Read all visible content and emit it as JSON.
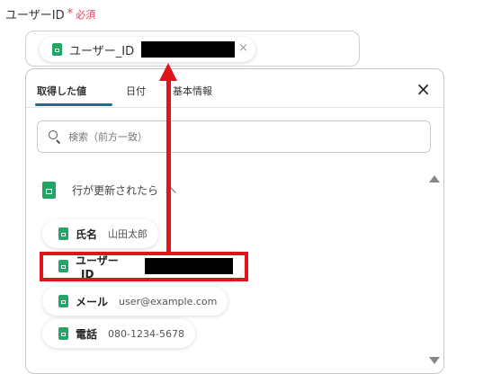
{
  "field": {
    "label": "ユーザーID",
    "required_mark": "*",
    "required_text": "必須",
    "token": {
      "label": "ユーザー_ID",
      "remove": "×"
    }
  },
  "popup": {
    "tabs": [
      {
        "label": "取得した値",
        "active": true
      },
      {
        "label": "日付",
        "active": false
      },
      {
        "label": "基本情報",
        "active": false
      }
    ],
    "close_label": "×",
    "search": {
      "placeholder": "検索（前方一致）",
      "value": ""
    },
    "group": {
      "title": "行が更新されたら",
      "items": [
        {
          "label": "氏名",
          "value": "山田太郎"
        },
        {
          "label": "ユーザー_ID",
          "value": ""
        },
        {
          "label": "メール",
          "value": "user@example.com"
        },
        {
          "label": "電話",
          "value": "080-1234-5678"
        }
      ]
    }
  },
  "colors": {
    "accent": "#1f6b8c",
    "sheets_green": "#23a566",
    "annotation_red": "#e0151b",
    "required_red": "#e0445a"
  }
}
